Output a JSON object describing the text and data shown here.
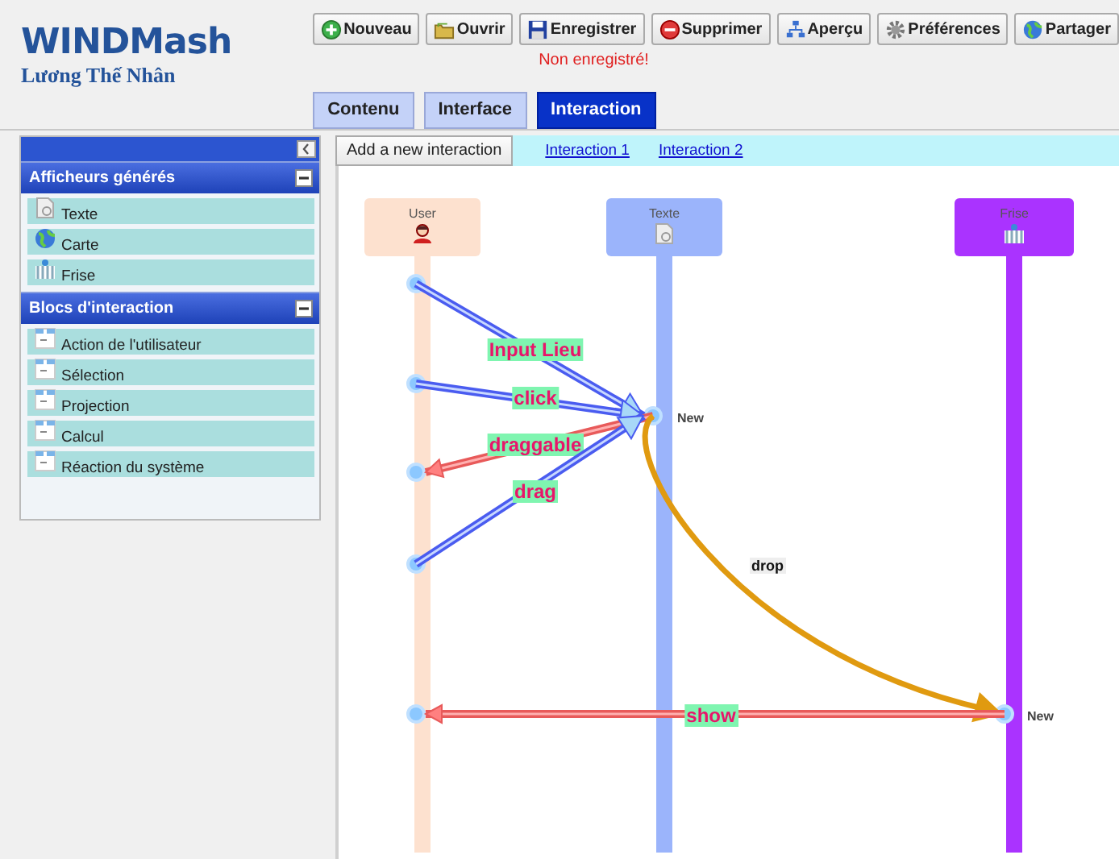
{
  "app": {
    "title": "WINDMash",
    "author": "Lương Thế Nhân"
  },
  "toolbar": [
    {
      "label": "Nouveau"
    },
    {
      "label": "Ouvrir"
    },
    {
      "label": "Enregistrer"
    },
    {
      "label": "Supprimer"
    },
    {
      "label": "Aperçu"
    },
    {
      "label": "Préférences"
    },
    {
      "label": "Partager"
    }
  ],
  "save_status": "Non enregistré!",
  "tabs": [
    {
      "label": "Contenu",
      "selected": false
    },
    {
      "label": "Interface",
      "selected": false
    },
    {
      "label": "Interaction",
      "selected": true
    }
  ],
  "sidebar": {
    "sections": [
      {
        "title": "Afficheurs générés",
        "expanded": true,
        "items": [
          {
            "label": "Texte"
          },
          {
            "label": "Carte"
          },
          {
            "label": "Frise"
          }
        ]
      },
      {
        "title": "Blocs d'interaction",
        "expanded": true,
        "items": [
          {
            "label": "Action de l'utilisateur"
          },
          {
            "label": "Sélection"
          },
          {
            "label": "Projection"
          },
          {
            "label": "Calcul"
          },
          {
            "label": "Réaction du système"
          }
        ]
      }
    ]
  },
  "interaction_bar": {
    "add_button": "Add a new interaction",
    "links": [
      "Interaction 1",
      "Interaction 2"
    ]
  },
  "diagram": {
    "lifelines": [
      {
        "name": "User",
        "color": "#fde1cf"
      },
      {
        "name": "Texte",
        "color": "#9bb4fb",
        "activation": "New"
      },
      {
        "name": "Frise",
        "color": "#aa33ff",
        "activation": "New"
      }
    ],
    "messages": [
      {
        "label": "Input Lieu",
        "kind": "event",
        "color": "#4a5cf0"
      },
      {
        "label": "click",
        "kind": "event",
        "color": "#4a5cf0"
      },
      {
        "label": "draggable",
        "kind": "reply",
        "color": "#e85a5a"
      },
      {
        "label": "drag",
        "kind": "event",
        "color": "#4a5cf0"
      },
      {
        "label": "drop",
        "kind": "transfer",
        "color": "#e09a10"
      },
      {
        "label": "show",
        "kind": "reply",
        "color": "#e85a5a"
      }
    ]
  }
}
